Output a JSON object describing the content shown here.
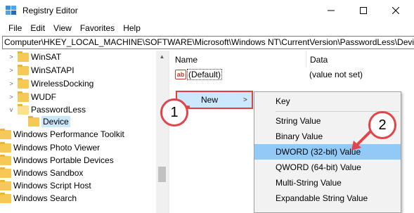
{
  "window": {
    "title": "Registry Editor"
  },
  "menu": [
    "File",
    "Edit",
    "View",
    "Favorites",
    "Help"
  ],
  "address": "Computer\\HKEY_LOCAL_MACHINE\\SOFTWARE\\Microsoft\\Windows NT\\CurrentVersion\\PasswordLess\\Device",
  "tree": {
    "items": [
      {
        "label": "WinSAT",
        "expander": ">"
      },
      {
        "label": "WinSATAPI",
        "expander": ">"
      },
      {
        "label": "WirelessDocking",
        "expander": ">"
      },
      {
        "label": "WUDF",
        "expander": ">"
      },
      {
        "label": "PasswordLess",
        "expander": "v"
      },
      {
        "label": "Device",
        "expander": ""
      },
      {
        "label": "Windows Performance Toolkit",
        "expander": ""
      },
      {
        "label": "Windows Photo Viewer",
        "expander": ""
      },
      {
        "label": "Windows Portable Devices",
        "expander": ""
      },
      {
        "label": "Windows Sandbox",
        "expander": ""
      },
      {
        "label": "Windows Script Host",
        "expander": ""
      },
      {
        "label": "Windows Search",
        "expander": ""
      }
    ]
  },
  "list": {
    "headers": {
      "name": "Name",
      "data": "Data"
    },
    "rows": [
      {
        "icon": "ab",
        "name": "(Default)",
        "data": "(value not set)"
      }
    ]
  },
  "context_menu": {
    "new_label": "New",
    "new_arrow": ">"
  },
  "submenu": {
    "items": [
      "Key",
      "String Value",
      "Binary Value",
      "DWORD (32-bit) Value",
      "QWORD (64-bit) Value",
      "Multi-String Value",
      "Expandable String Value"
    ],
    "highlighted": "DWORD (32-bit) Value"
  },
  "annotations": {
    "step1": "1",
    "step2": "2",
    "color": "#e0454a"
  }
}
